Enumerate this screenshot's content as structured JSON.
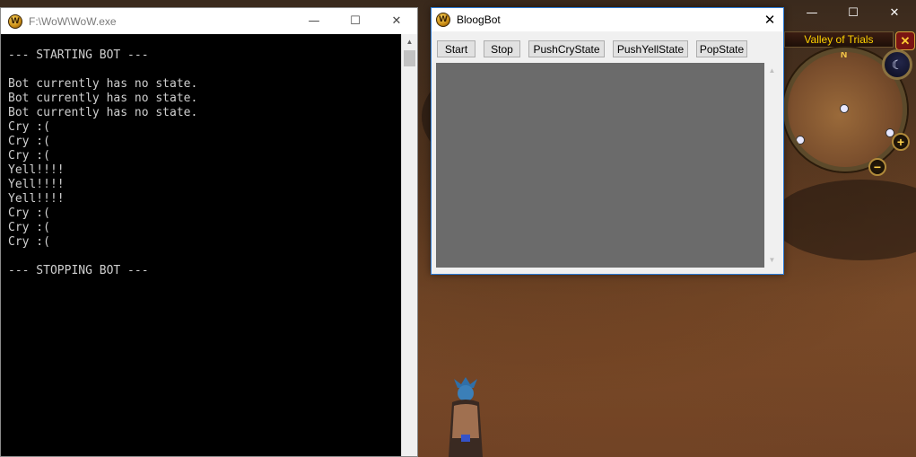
{
  "console": {
    "title": "F:\\WoW\\WoW.exe",
    "output": "--- STARTING BOT ---\n\nBot currently has no state.\nBot currently has no state.\nBot currently has no state.\nCry :(\nCry :(\nCry :(\nYell!!!!\nYell!!!!\nYell!!!!\nCry :(\nCry :(\nCry :(\n\n--- STOPPING BOT ---",
    "icons": {
      "minimize": "—",
      "maximize": "☐",
      "close": "✕"
    }
  },
  "bot": {
    "title": "BloogBot",
    "close": "✕",
    "buttons": {
      "start": "Start",
      "stop": "Stop",
      "push_cry": "PushCryState",
      "push_yell": "PushYellState",
      "pop": "PopState"
    }
  },
  "game": {
    "zone": "Valley of Trials",
    "minimap_close": "✕",
    "north": "N",
    "zoom_in": "+",
    "zoom_out": "−",
    "time_icon": "moon-icon",
    "window_icons": {
      "minimize": "—",
      "maximize": "☐",
      "close": "✕"
    }
  },
  "colors": {
    "console_bg": "#000000",
    "console_text": "#cfcfcf",
    "bot_output_bg": "#6b6b6b",
    "active_border": "#2b7bd6",
    "zone_text": "#ffd200"
  }
}
